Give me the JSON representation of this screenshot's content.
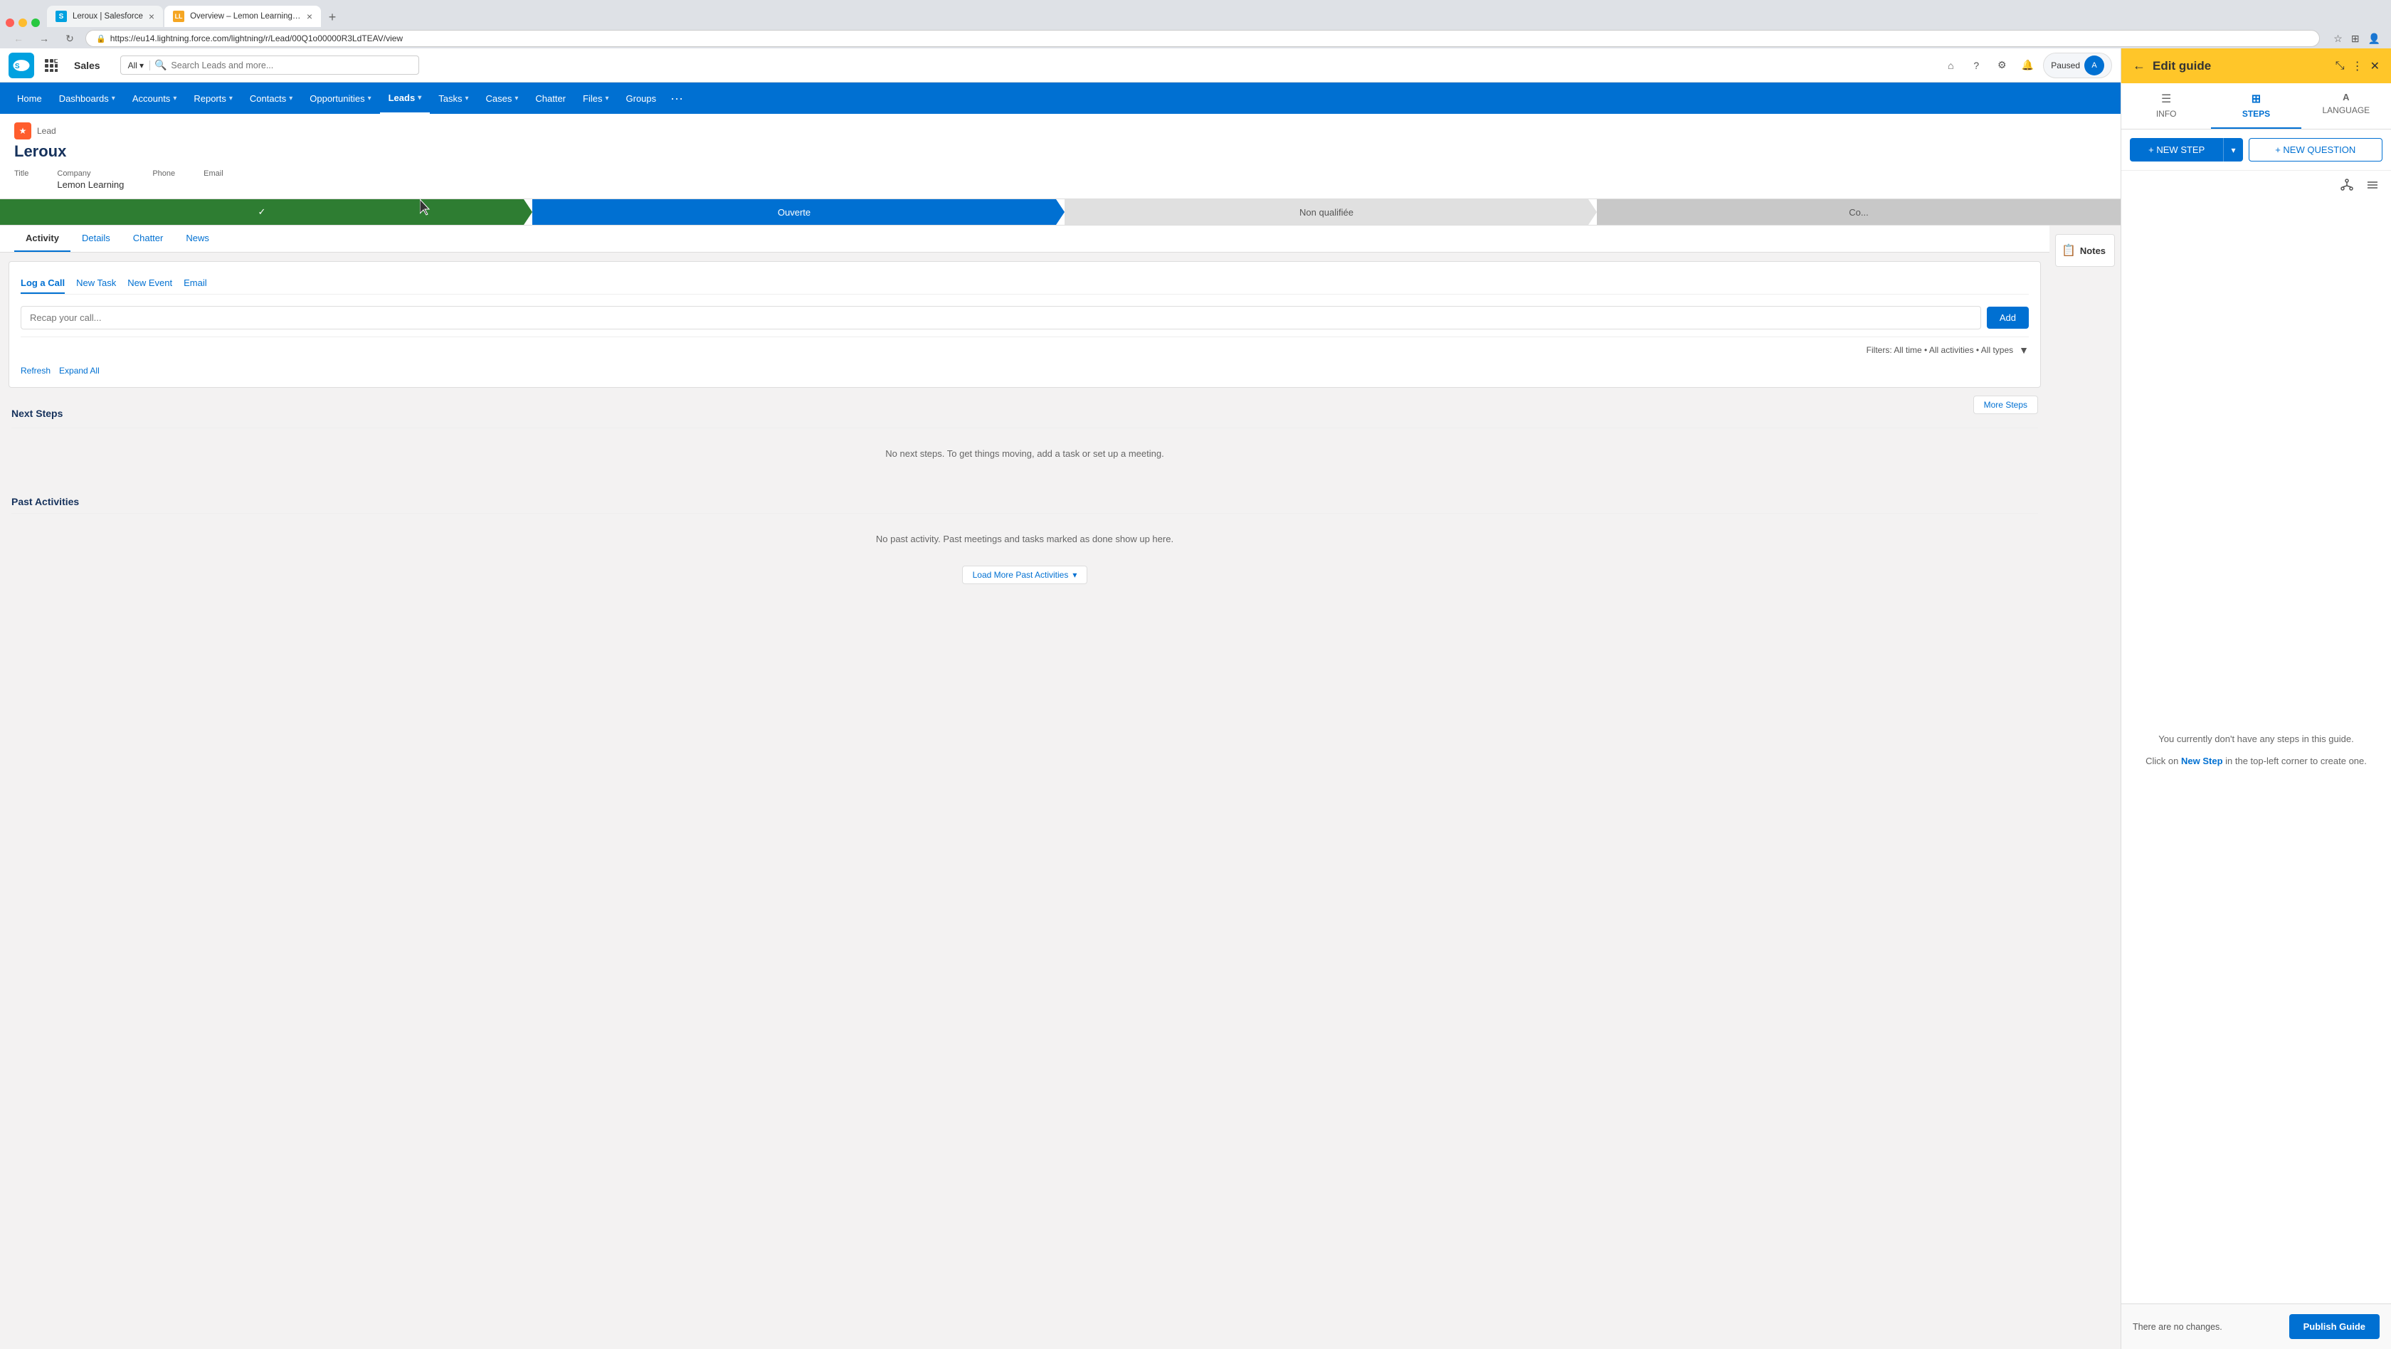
{
  "browser": {
    "tabs": [
      {
        "id": "tab1",
        "title": "Leroux | Salesforce",
        "favicon": "SF",
        "active": false,
        "url": ""
      },
      {
        "id": "tab2",
        "title": "Overview – Lemon Learning Ad",
        "favicon": "LL",
        "active": true,
        "url": "https://eu14.lightning.force.com/lightning/r/Lead/00Q1o00000R3LdTEAV/view"
      }
    ],
    "url": "https://eu14.lightning.force.com/lightning/r/Lead/00Q1o00000R3LdTEAV/view",
    "nav": {
      "back_disabled": false,
      "forward_disabled": false
    },
    "right_actions": {
      "paused_label": "Paused",
      "avatar_initials": "A"
    }
  },
  "salesforce": {
    "app_name": "Sales",
    "search_placeholder": "Search Leads and more...",
    "search_all": "All",
    "navbar": {
      "items": [
        {
          "label": "Home",
          "dropdown": false,
          "active": false
        },
        {
          "label": "Dashboards",
          "dropdown": true,
          "active": false
        },
        {
          "label": "Accounts",
          "dropdown": true,
          "active": false
        },
        {
          "label": "Reports",
          "dropdown": true,
          "active": false
        },
        {
          "label": "Contacts",
          "dropdown": true,
          "active": false
        },
        {
          "label": "Opportunities",
          "dropdown": true,
          "active": false
        },
        {
          "label": "Leads",
          "dropdown": true,
          "active": true
        },
        {
          "label": "Tasks",
          "dropdown": true,
          "active": false
        },
        {
          "label": "Cases",
          "dropdown": true,
          "active": false
        },
        {
          "label": "Chatter",
          "dropdown": false,
          "active": false
        },
        {
          "label": "Files",
          "dropdown": true,
          "active": false
        },
        {
          "label": "Groups",
          "dropdown": false,
          "active": false
        }
      ]
    },
    "lead": {
      "type_label": "Lead",
      "name": "Leroux",
      "fields": [
        {
          "label": "Title",
          "value": ""
        },
        {
          "label": "Company",
          "value": "Lemon Learning"
        },
        {
          "label": "Phone",
          "value": ""
        },
        {
          "label": "Email",
          "value": ""
        }
      ],
      "status_steps": [
        {
          "label": "✓",
          "type": "done"
        },
        {
          "label": "Ouverte",
          "type": "active"
        },
        {
          "label": "Non qualifiée",
          "type": "pending"
        },
        {
          "label": "Co...",
          "type": "pending2"
        }
      ]
    },
    "tabs": [
      {
        "label": "Activity",
        "active": true
      },
      {
        "label": "Details",
        "active": false
      },
      {
        "label": "Chatter",
        "active": false
      },
      {
        "label": "News",
        "active": false
      }
    ],
    "activity": {
      "subtabs": [
        {
          "label": "Log a Call",
          "active": true
        },
        {
          "label": "New Task",
          "active": false
        },
        {
          "label": "New Event",
          "active": false
        },
        {
          "label": "Email",
          "active": false
        }
      ],
      "input_placeholder": "Recap your call...",
      "add_button": "Add",
      "filters_label": "Filters: All time • All activities • All types",
      "refresh_label": "Refresh",
      "expand_all_label": "Expand All"
    },
    "next_steps": {
      "title": "Next Steps",
      "more_button": "More Steps",
      "empty_message": "No next steps. To get things moving, add a task or set up a meeting."
    },
    "past_activities": {
      "title": "Past Activities",
      "empty_message": "No past activity. Past meetings and tasks marked as done show up here.",
      "load_more_button": "Load More Past Activities"
    },
    "notes": {
      "title": "Notes"
    }
  },
  "edit_guide": {
    "header_title": "Edit guide",
    "back_icon": "←",
    "tabs": [
      {
        "label": "INFO",
        "icon": "☰",
        "active": false
      },
      {
        "label": "STEPS",
        "icon": "⊞",
        "active": true
      },
      {
        "label": "LANGUAGE",
        "icon": "A",
        "active": false
      }
    ],
    "new_step_button": "+ NEW STEP",
    "new_question_button": "+ NEW QUESTION",
    "empty_message_1": "You currently don't have any steps in this guide.",
    "empty_message_2": "Click on",
    "empty_link": "New Step",
    "empty_message_3": "in the top-left corner to create one.",
    "footer_text": "There are no changes.",
    "publish_button": "Publish Guide"
  }
}
